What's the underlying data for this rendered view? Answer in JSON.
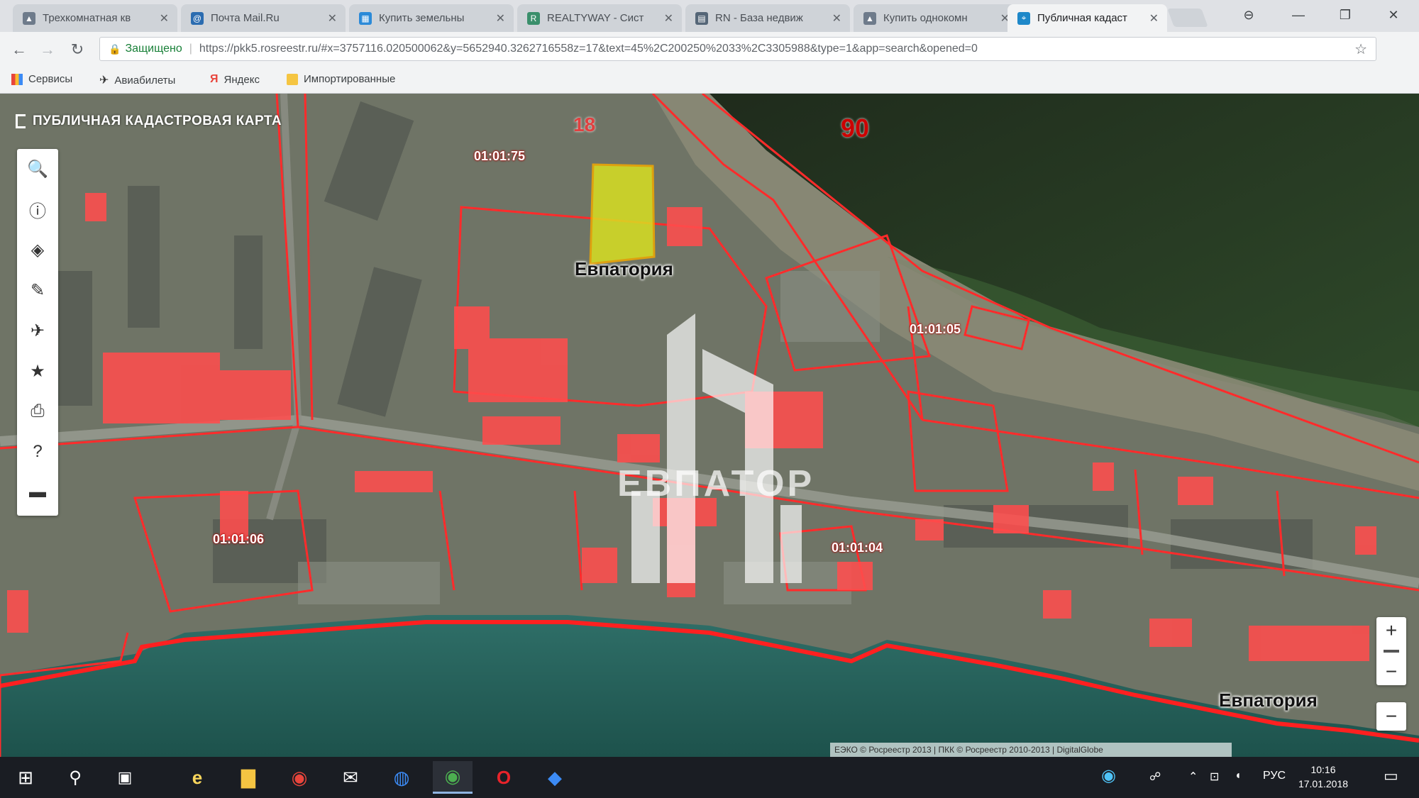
{
  "browser": {
    "tabs": [
      {
        "title": "Трехкомнатная кв",
        "icon": "house-icon",
        "color": "#6e7b8b"
      },
      {
        "title": "Почта Mail.Ru",
        "icon": "mail-icon",
        "color": "#2b6cb0"
      },
      {
        "title": "Купить земельны",
        "icon": "squares-icon",
        "color": "#2b8ad8"
      },
      {
        "title": "REALTYWAY - Сист",
        "icon": "r-icon",
        "color": "#3a8f6b"
      },
      {
        "title": "RN - База недвиж",
        "icon": "grid-icon",
        "color": "#556677"
      },
      {
        "title": "Купить однокомн",
        "icon": "house-icon",
        "color": "#6e7b8b"
      },
      {
        "title": "Публичная кадаст",
        "icon": "map-icon",
        "color": "#1e88c9",
        "active": true
      }
    ],
    "close_glyph": "✕",
    "window_buttons": {
      "profile": "⊖",
      "minimize": "—",
      "maximize": "❐",
      "close": "✕"
    },
    "nav": {
      "back": "←",
      "forward": "→",
      "reload": "↻"
    },
    "address": {
      "secure_label": "Защищено",
      "separator": "|",
      "url": "https://pkk5.rosreestr.ru/#x=3757116.020500062&y=5652940.3262716558z=17&text=45%2C200250%2033%2C3305988&type=1&app=search&opened=0",
      "star": "☆"
    },
    "bookmarks": [
      {
        "label": "Сервисы",
        "icon": "apps-icon"
      },
      {
        "label": "Авиабилеты",
        "icon": "plane-icon"
      },
      {
        "label": "Яндекс",
        "icon": "yandex-icon"
      },
      {
        "label": "Импортированные",
        "icon": "folder-icon"
      }
    ]
  },
  "map": {
    "title": "ПУБЛИЧНАЯ КАДАСТРОВАЯ КАРТА",
    "tools": [
      {
        "name": "search",
        "glyph": "🔍"
      },
      {
        "name": "info",
        "glyph": "ⓘ"
      },
      {
        "name": "layers",
        "glyph": "◈"
      },
      {
        "name": "pencil",
        "glyph": "✎"
      },
      {
        "name": "satellite",
        "glyph": "✈"
      },
      {
        "name": "favorites",
        "glyph": "★"
      },
      {
        "name": "print",
        "glyph": "⎙"
      },
      {
        "name": "help",
        "glyph": "?"
      },
      {
        "name": "keyboard",
        "glyph": "▬"
      }
    ],
    "labels": {
      "city_top": "Евпатория",
      "city_bottom": "Евпатория",
      "region_90": "90",
      "region_18": "18",
      "quarter_1": "01:01:75",
      "quarter_2": "01:01:05",
      "quarter_3": "01:01:06",
      "quarter_4": "01:01:04"
    },
    "watermark_text": "ЕВПАТОР",
    "zoom": {
      "in": "+",
      "out": "−"
    },
    "attribution": "ЕЭКО © Росреестр 2013 | ПКК © Росреестр 2010-2013 | DigitalGlobe",
    "highlight_color": "#d9e021",
    "parcel_color": "#ff2b2b"
  },
  "taskbar": {
    "start": "⊞",
    "search": "⚲",
    "taskview": "▣",
    "apps": [
      {
        "name": "ie",
        "glyph": "e"
      },
      {
        "name": "explorer",
        "glyph": "▇"
      },
      {
        "name": "chrome",
        "glyph": "◉"
      },
      {
        "name": "mail",
        "glyph": "✉"
      },
      {
        "name": "earth",
        "glyph": "◍"
      },
      {
        "name": "chrome-active",
        "glyph": "◉"
      },
      {
        "name": "opera",
        "glyph": "O"
      },
      {
        "name": "app",
        "glyph": "◆"
      }
    ],
    "tray": {
      "lang": "РУС",
      "time": "10:16",
      "date": "17.01.2018"
    }
  }
}
